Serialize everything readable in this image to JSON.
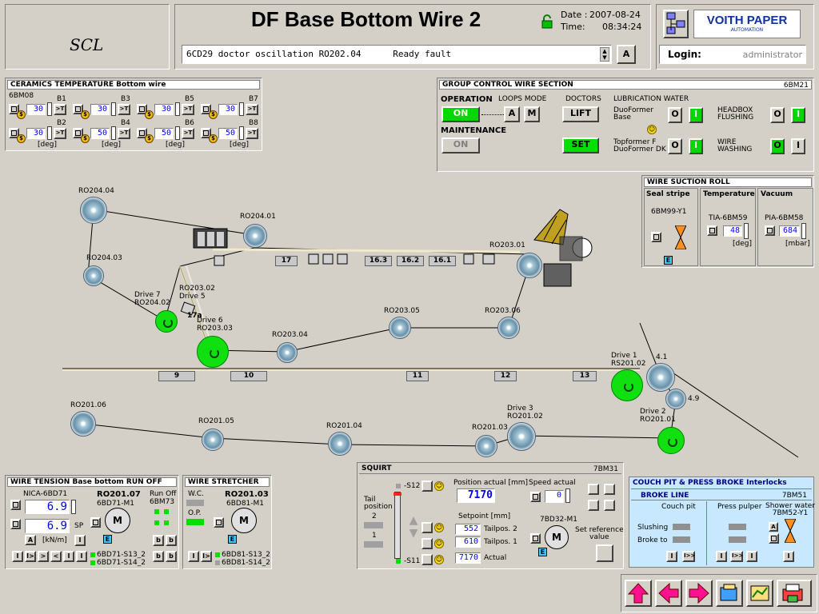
{
  "header": {
    "brand": "SCL",
    "title": "DF Base Bottom Wire 2",
    "date_label": "Date :",
    "date_value": "2007-08-24",
    "time_label": "Time:",
    "time_value": "08:34:24",
    "message": "6CD29 doctor oscillation RO202.04      Ready fault",
    "ack_label": "A",
    "logo_line1": "VOITH PAPER",
    "logo_line2": "AUTOMATION",
    "login_label": "Login:",
    "login_user": "administrator"
  },
  "ceramics": {
    "title": "CERAMICS TEMPERATURE   Bottom wire",
    "group_tag": "6BM08",
    "unit": "[deg]",
    "items": [
      {
        "tag": "B1",
        "value": "30"
      },
      {
        "tag": "B2",
        "value": "30"
      },
      {
        "tag": "B3",
        "value": "30"
      },
      {
        "tag": "B4",
        "value": "50"
      },
      {
        "tag": "B5",
        "value": "30"
      },
      {
        "tag": "B6",
        "value": "50"
      },
      {
        "tag": "B7",
        "value": "30"
      },
      {
        "tag": "B8",
        "value": "50"
      }
    ]
  },
  "group_control": {
    "title": "GROUP CONTROL WIRE SECTION",
    "tag": "6BM21",
    "operation_label": "OPERATION",
    "loops_mode_label": "LOOPS MODE",
    "on_label": "ON",
    "loop_a": "A",
    "loop_m": "M",
    "maintenance_label": "MAINTENANCE",
    "maint_on_label": "ON",
    "doctors_label": "DOCTORS",
    "lift_label": "LIFT",
    "set_label": "SET",
    "lubrication_label": "LUBRICATION WATER",
    "duoformer_base": "DuoFormer\nBase",
    "topformer": "Topformer F\nDuoFormer DK",
    "headbox_flushing": "HEADBOX\nFLUSHING",
    "wire_washing": "WIRE\nWASHING",
    "o_label": "O",
    "i_label": "I"
  },
  "suction_roll": {
    "title": "WIRE SUCTION ROLL",
    "seal_stripe": "Seal stripe",
    "seal_tag": "6BM99-Y1",
    "temperature": "Temperature",
    "temp_tag": "TIA-6BM59",
    "temp_value": "48",
    "temp_unit": "[deg]",
    "vacuum": "Vacuum",
    "vac_tag": "PIA-6BM58",
    "vac_value": "684",
    "vac_unit": "[mbar]",
    "e_label": "E"
  },
  "diagram": {
    "rolls": {
      "ro204_04": "RO204.04",
      "ro204_01": "RO204.01",
      "ro204_03": "RO204.03",
      "ro203_01": "RO203.01",
      "drive7": "Drive 7\nRO204.02",
      "ro203_02": "RO203.02\nDrive 5",
      "drive6": "Drive 6\nRO203.03",
      "ro203_04": "RO203.04",
      "ro203_05": "RO203.05",
      "ro203_06": "RO203.06",
      "drive1": "Drive 1\nRS201.02",
      "r41": "4.1",
      "r49": "4.9",
      "drive2": "Drive 2\nRO201.01",
      "ro201_06": "RO201.06",
      "ro201_05": "RO201.05",
      "ro201_04": "RO201.04",
      "ro201_03": "RO201.03",
      "drive3": "Drive 3\nRO201.02",
      "r17a": "17a"
    },
    "foils": [
      "17",
      "16.3",
      "16.2",
      "16.1",
      "9",
      "10",
      "11",
      "12",
      "13"
    ]
  },
  "wire_tension": {
    "title": "WIRE TENSION   Base bottom   RUN OFF",
    "tag": "NICA-6BD71",
    "value1": "6.9",
    "value2": "6.9",
    "sp_label": "SP",
    "unit": "[kN/m]",
    "a_label": "A",
    "motor_tag": "RO201.07",
    "motor_sub": "6BD71-M1",
    "run_off": "Run Off",
    "run_off_tag": "6BM73",
    "m_label": "M",
    "e_label": "E",
    "leg1": "6BD71-S13_2",
    "leg2": "6BD71-S14_2"
  },
  "wire_stretcher": {
    "title": "WIRE STRETCHER",
    "wc": "W.C.",
    "op": "O.P.",
    "motor_tag": "RO201.03",
    "motor_sub": "6BD81-M1",
    "m_label": "M",
    "e_label": "E",
    "leg1": "6BD81-S13_2",
    "leg2": "6BD81-S14_2"
  },
  "squirt": {
    "title": "SQUIRT",
    "tag": "7BM31",
    "s12": "-S12",
    "s11": "-S11",
    "tail_position": "Tail\nposition",
    "pos2": "2",
    "pos1": "1",
    "position_actual_label": "Position actual  [mm]",
    "position_actual": "7170",
    "speed_actual_label": "Speed actual",
    "speed_actual": "0",
    "setpoint_label": "Setpoint   [mm]",
    "tailpos2": "552",
    "tailpos2_label": "Tailpos. 2",
    "tailpos1": "610",
    "tailpos1_label": "Tailpos. 1",
    "actual": "7170",
    "actual_label": "Actual",
    "motor_tag": "7BD32-M1",
    "m_label": "M",
    "e_label": "E",
    "setref_label": "Set reference\nvalue"
  },
  "couch_pit": {
    "title": "COUCH PIT & PRESS BROKE Interlocks",
    "broke_line": "BROKE LINE",
    "tag": "7BM51",
    "couch_pit": "Couch pit",
    "press_pulper": "Press pulper",
    "shower_water": "Shower water\n7BM52-Y1",
    "slushing": "Slushing",
    "broke_to": "Broke to",
    "a_label": "A"
  },
  "colors": {
    "on_green": "#00d800",
    "value_blue": "#0000ff",
    "nav_pink": "#ff1090"
  }
}
